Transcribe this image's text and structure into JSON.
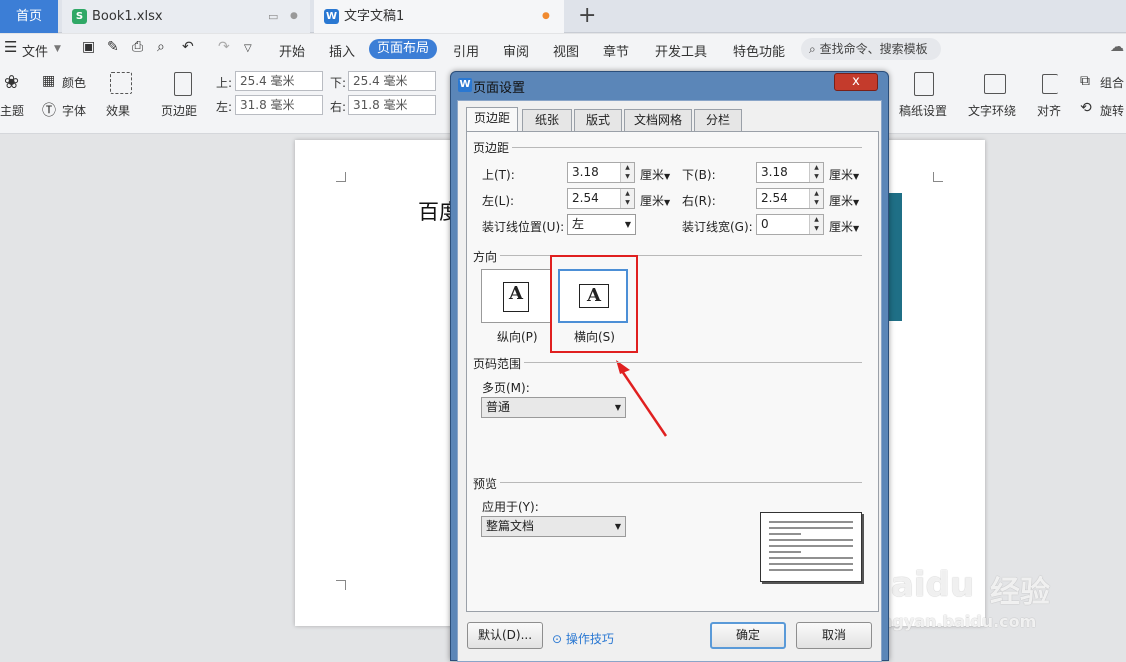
{
  "tabs": {
    "home": "首页",
    "book": "Book1.xlsx",
    "doc": "文字文稿1",
    "new_tab": "+"
  },
  "menu": {
    "file": "文件",
    "items": [
      "开始",
      "插入",
      "页面布局",
      "引用",
      "审阅",
      "视图",
      "章节",
      "开发工具",
      "特色功能"
    ],
    "active": "页面布局",
    "search": "查找命令、搜索模板"
  },
  "ribbon": {
    "color": "颜色",
    "theme": "主题",
    "font": "字体",
    "effect": "效果",
    "margins": "页边距",
    "top_label": "上:",
    "top_value": "25.4 毫米",
    "bottom_label": "下:",
    "bottom_value": "25.4 毫米",
    "left_label": "左:",
    "left_value": "31.8 毫米",
    "right_label": "右:",
    "right_value": "31.8 毫米",
    "manuscript": "稿纸设置",
    "wrap": "文字环绕",
    "align": "对齐",
    "group": "组合",
    "rotate": "旋转"
  },
  "document": {
    "text": "百度"
  },
  "dialog": {
    "title": "页面设置",
    "close": "x",
    "tabs": [
      "页边距",
      "纸张",
      "版式",
      "文档网格",
      "分栏"
    ],
    "active_tab": "页边距",
    "margins_section": "页边距",
    "top_label": "上(T):",
    "top_value": "3.18",
    "bottom_label": "下(B):",
    "bottom_value": "3.18",
    "left_label": "左(L):",
    "left_value": "2.54",
    "right_label": "右(R):",
    "right_value": "2.54",
    "unit": "厘米",
    "gutter_pos_label": "装订线位置(U):",
    "gutter_pos_value": "左",
    "gutter_width_label": "装订线宽(G):",
    "gutter_width_value": "0",
    "orientation_section": "方向",
    "portrait": "纵向(P)",
    "landscape": "横向(S)",
    "orientation_selected": "横向(S)",
    "glyph": "A",
    "pages_section": "页码范围",
    "multiple_pages_label": "多页(M):",
    "multiple_pages_value": "普通",
    "preview_section": "预览",
    "apply_to_label": "应用于(Y):",
    "apply_to_value": "整篇文档",
    "default_button": "默认(D)...",
    "tips_link": "操作技巧",
    "ok_button": "确定",
    "cancel_button": "取消"
  },
  "watermark": {
    "brand": "Baidu",
    "brand_cn": "经验",
    "url": "jingyan.baidu.com"
  },
  "colors": {
    "accent": "#3c7ed6",
    "highlight": "#e02020",
    "dialog_frame": "#5b86b8"
  }
}
